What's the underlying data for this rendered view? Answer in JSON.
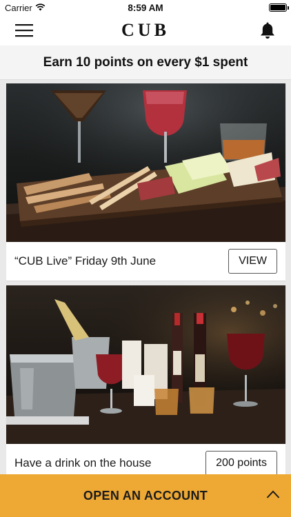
{
  "status_bar": {
    "carrier": "Carrier",
    "time": "8:59 AM",
    "wifi_icon": "wifi-icon",
    "battery_icon": "battery-icon"
  },
  "nav_bar": {
    "brand": "CUB",
    "menu_icon": "hamburger-menu-icon",
    "notifications_icon": "bell-icon"
  },
  "promo": {
    "text": "Earn 10 points on every $1 spent"
  },
  "cards": [
    {
      "title": "“CUB Live” Friday 9th June",
      "action_label": "VIEW",
      "image": "food-platter-photo"
    },
    {
      "title": "Have a drink on the house",
      "action_label": "200 points",
      "image": "bar-drinks-photo"
    }
  ],
  "cta": {
    "label": "OPEN AN ACCOUNT",
    "icon": "chevron-up-icon"
  },
  "colors": {
    "accent": "#eea834",
    "background": "#e9e9e9",
    "card": "#ffffff"
  }
}
